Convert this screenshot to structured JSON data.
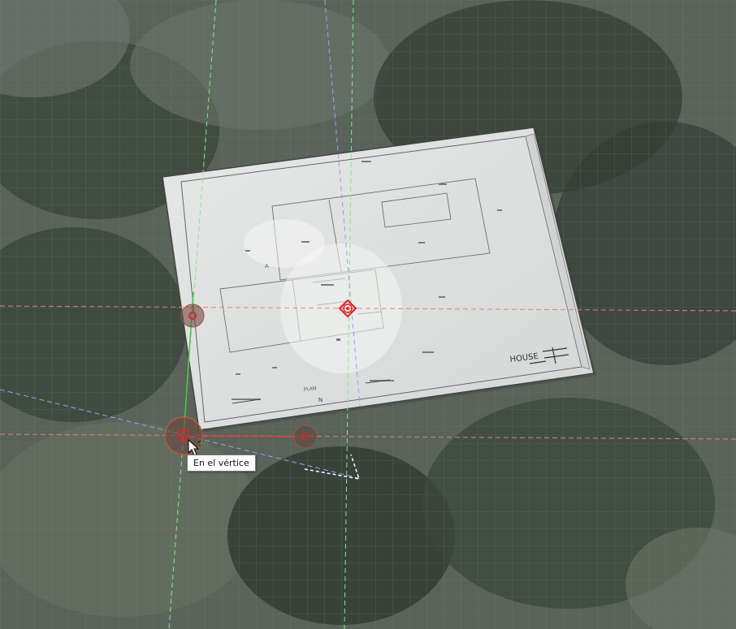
{
  "viewport": {
    "tooltip_text": "En el vértice",
    "cursor_icon": "arrow-cursor-with-snap-icon"
  },
  "drawing_sheet": {
    "house_label": "HOUSE",
    "plan_label": "PLAN",
    "north_label": "N",
    "section_marker": "A"
  },
  "colors": {
    "grid": "#6f7d72",
    "red_axis": "#d94a4a",
    "green_axis": "#55cc55",
    "blue_axis": "#8a8ce0",
    "gizmo": "#c83232"
  }
}
